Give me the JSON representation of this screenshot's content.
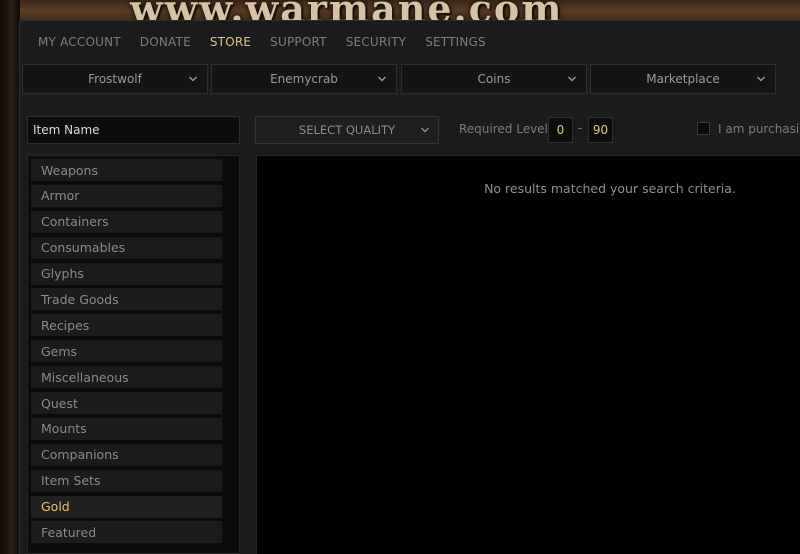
{
  "banner": {
    "text": "www.warmane.com"
  },
  "nav": {
    "items": [
      {
        "label": "MY ACCOUNT",
        "active": false
      },
      {
        "label": "DONATE",
        "active": false
      },
      {
        "label": "STORE",
        "active": true
      },
      {
        "label": "SUPPORT",
        "active": false
      },
      {
        "label": "SECURITY",
        "active": false
      },
      {
        "label": "SETTINGS",
        "active": false
      }
    ]
  },
  "selectors": {
    "realm": "Frostwolf",
    "character": "Enemycrab",
    "currency": "Coins",
    "store": "Marketplace"
  },
  "filters": {
    "item_name_placeholder": "Item Name",
    "quality": "SELECT QUALITY",
    "required_level_label": "Required Level:",
    "level_min": "0",
    "level_separator": "-",
    "level_max": "90",
    "purchasing_label": "I am purchasing"
  },
  "categories": [
    {
      "label": "Weapons",
      "active": false
    },
    {
      "label": "Armor",
      "active": false
    },
    {
      "label": "Containers",
      "active": false
    },
    {
      "label": "Consumables",
      "active": false
    },
    {
      "label": "Glyphs",
      "active": false
    },
    {
      "label": "Trade Goods",
      "active": false
    },
    {
      "label": "Recipes",
      "active": false
    },
    {
      "label": "Gems",
      "active": false
    },
    {
      "label": "Miscellaneous",
      "active": false
    },
    {
      "label": "Quest",
      "active": false
    },
    {
      "label": "Mounts",
      "active": false
    },
    {
      "label": "Companions",
      "active": false
    },
    {
      "label": "Item Sets",
      "active": false
    },
    {
      "label": "Gold",
      "active": true
    },
    {
      "label": "Featured",
      "active": false
    }
  ],
  "results": {
    "empty_message": "No results matched your search criteria."
  },
  "colors": {
    "accent": "#e2c37a",
    "panel": "#1b1b1b",
    "results_bg": "#000000"
  }
}
